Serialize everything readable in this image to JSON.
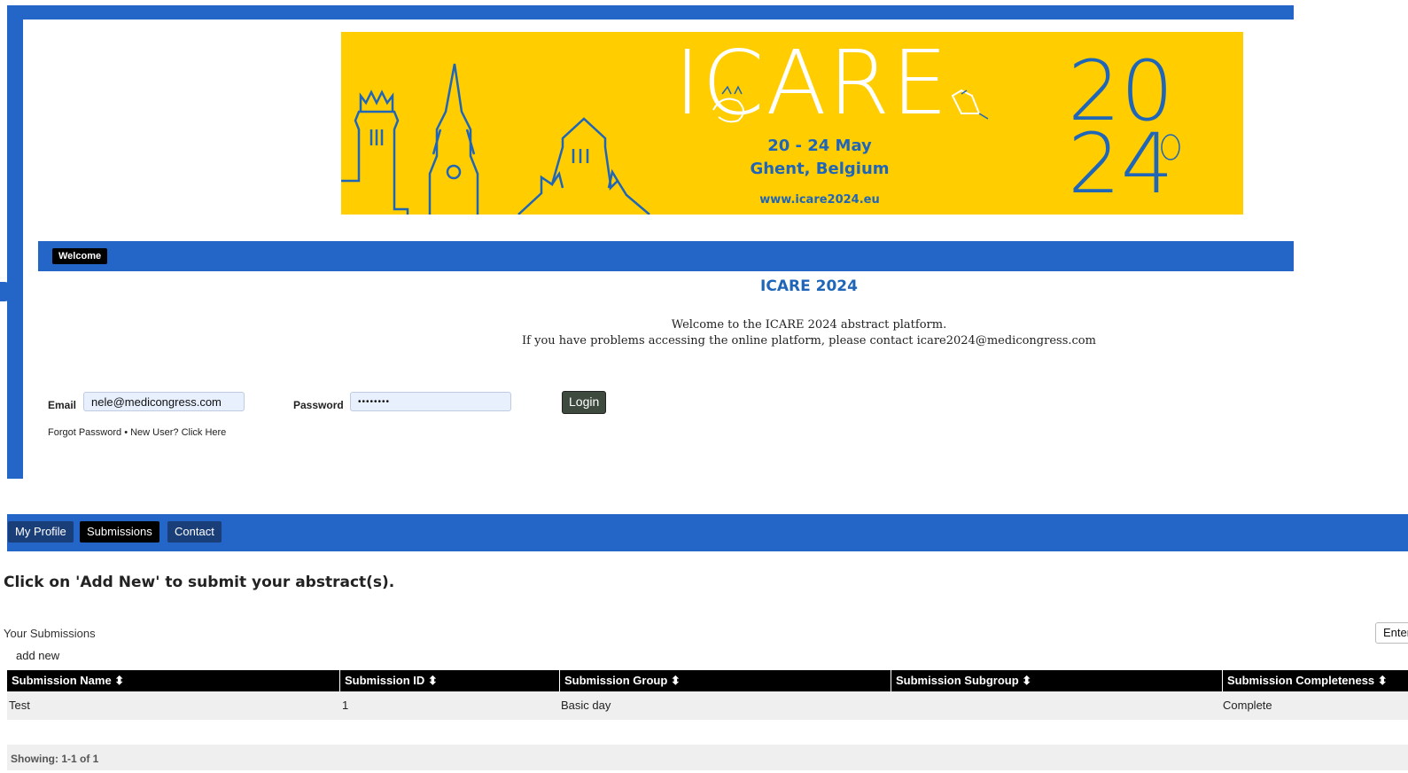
{
  "banner": {
    "title": "ICARE",
    "dates": "20 - 24 May",
    "place": "Ghent, Belgium",
    "url": "www.icare2024.eu",
    "year_top": "20",
    "year_bottom": "24",
    "colors": {
      "background": "#ffcd00",
      "accent": "#1f66b9"
    }
  },
  "nav_top": {
    "tabs": [
      {
        "label": "Welcome"
      }
    ]
  },
  "page": {
    "heading": "ICARE 2024",
    "welcome_line1": "Welcome to the ICARE 2024 abstract platform.",
    "welcome_line2": "If you have problems accessing the online platform, please contact icare2024@medicongress.com"
  },
  "login": {
    "email_label": "Email",
    "email_value": "nele@medicongress.com",
    "password_label": "Password",
    "password_value": "••••••••",
    "button_label": "Login",
    "forgot_text": "Forgot Password • New User? Click Here"
  },
  "nav_main": {
    "tabs": [
      {
        "label": "My Profile"
      },
      {
        "label": "Submissions"
      },
      {
        "label": "Contact"
      }
    ]
  },
  "submissions": {
    "heading": "Click on 'Add New' to submit your abstract(s).",
    "section_label": "Your Submissions",
    "add_new": "add new",
    "search_value": "Enter",
    "columns": [
      "Submission Name ⬍",
      "Submission ID ⬍",
      "Submission Group ⬍",
      "Submission Subgroup ⬍",
      "Submission Completeness ⬍"
    ],
    "rows": [
      [
        "Test",
        "1",
        "Basic day",
        "",
        "Complete"
      ]
    ],
    "footer": "Showing: 1-1 of 1"
  },
  "theme": {
    "primary": "#2366c8",
    "dark": "#000000"
  }
}
